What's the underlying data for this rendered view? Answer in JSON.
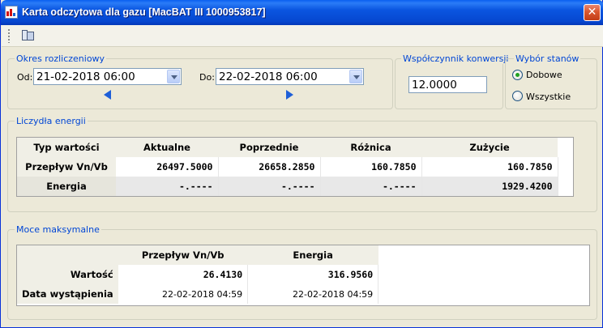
{
  "window": {
    "title": "Karta odczytowa dla gazu [MacBAT III 1000953817]",
    "close_glyph": "✕"
  },
  "toolbar": {
    "buttons": [
      {
        "icon": "split-view-icon"
      }
    ]
  },
  "period": {
    "legend": "Okres rozliczeniowy",
    "from_label": "Od:",
    "from_value": "21-02-2018 06:00",
    "to_label": "Do:",
    "to_value": "22-02-2018 06:00"
  },
  "conversion": {
    "legend": "Współczynnik konwersji",
    "value": "12.0000"
  },
  "states": {
    "legend": "Wybór stanów",
    "options": [
      {
        "label": "Dobowe",
        "checked": true
      },
      {
        "label": "Wszystkie",
        "checked": false
      }
    ]
  },
  "counters": {
    "legend": "Liczydła energii",
    "headers": [
      "Typ wartości",
      "Aktualne",
      "Poprzednie",
      "Różnica",
      "Zużycie"
    ],
    "rows": [
      {
        "label": "Przepływ Vn/Vb",
        "values": [
          "26497.5000",
          "26658.2850",
          "160.7850",
          "160.7850"
        ]
      },
      {
        "label": "Energia",
        "values": [
          "-.----",
          "-.----",
          "-.----",
          "1929.4200"
        ]
      }
    ]
  },
  "max_power": {
    "legend": "Moce maksymalne",
    "headers": [
      "",
      "Przepływ Vn/Vb",
      "Energia"
    ],
    "rows": [
      {
        "label": "Wartość",
        "values": [
          "26.4130",
          "316.9560"
        ]
      },
      {
        "label": "Data wystąpienia",
        "values": [
          "22-02-2018 04:59",
          "22-02-2018 04:59"
        ]
      }
    ]
  },
  "colors": {
    "title_bar": "#0a55e0",
    "legend_text": "#0046d5",
    "nav_arrow": "#1e5fd8",
    "radio_checked": "#21a121"
  }
}
